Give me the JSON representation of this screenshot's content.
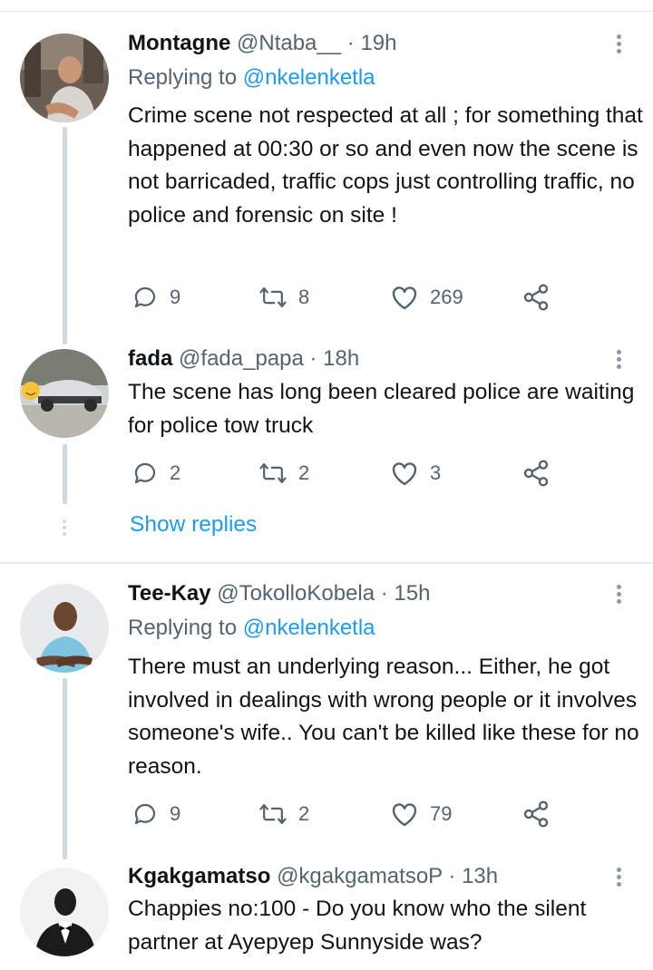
{
  "tweets": [
    {
      "name": "Montagne",
      "handle": "@Ntaba__",
      "sep": " · ",
      "time": "19h",
      "replying_prefix": "Replying to ",
      "replying_to": "@nkelenketla",
      "text": "Crime scene not respected at all ; for something that happened at 00:30 or so and even now the scene is not barricaded, traffic cops just controlling traffic, no police and forensic on site !",
      "replies": "9",
      "retweets": "8",
      "likes": "269"
    },
    {
      "name": "fada",
      "handle": "@fada_papa",
      "sep": " · ",
      "time": "18h",
      "text": "The scene has long been cleared police are waiting for police tow truck",
      "replies": "2",
      "retweets": "2",
      "likes": "3"
    },
    {
      "name": "Tee-Kay",
      "handle": "@TokolloKobela",
      "sep": " · ",
      "time": "15h",
      "replying_prefix": "Replying to ",
      "replying_to": "@nkelenketla",
      "text": "There must an underlying reason... Either, he got involved in dealings with wrong people or it involves someone's wife.. You can't be killed like these for no reason.",
      "replies": "9",
      "retweets": "2",
      "likes": "79"
    },
    {
      "name": "Kgakgamatso",
      "handle": "@kgakgamatsoP",
      "sep": " · ",
      "time": "13h",
      "text": "Chappies no:100 - Do you know who the silent partner at Ayepyep Sunnyside was?"
    }
  ],
  "show_replies": "Show replies",
  "colors": {
    "link": "#1d9bf0",
    "muted": "#536471",
    "text": "#0f1419",
    "thread": "#cfd9de"
  },
  "icons": [
    "reply-icon",
    "retweet-icon",
    "like-icon",
    "share-icon",
    "more-icon"
  ]
}
